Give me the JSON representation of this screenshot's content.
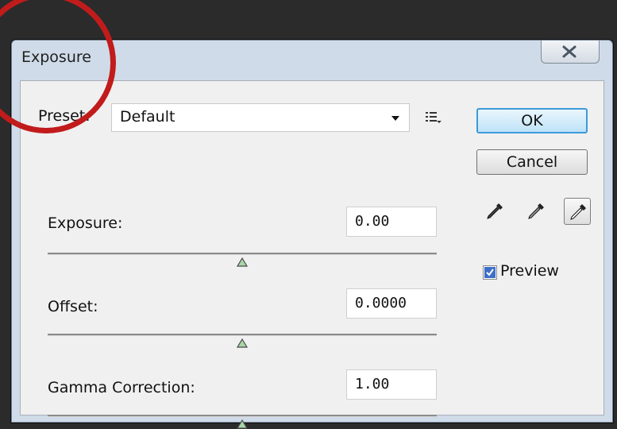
{
  "dialog": {
    "title": "Exposure",
    "close_label": "X"
  },
  "preset": {
    "label": "Preset:",
    "value": "Default"
  },
  "fields": [
    {
      "label": "Exposure:",
      "value": "0.00",
      "slider_level": 0.5
    },
    {
      "label": "Offset:",
      "value": "0.0000",
      "slider_level": 0.5
    },
    {
      "label": "Gamma Correction:",
      "value": "1.00",
      "slider_level": 0.5
    }
  ],
  "buttons": {
    "ok": "OK",
    "cancel": "Cancel"
  },
  "eyedroppers": [
    {
      "icon": "black-point-eyedropper-icon"
    },
    {
      "icon": "gray-point-eyedropper-icon"
    },
    {
      "icon": "white-point-eyedropper-icon",
      "selected": true
    }
  ],
  "preview": {
    "label": "Preview",
    "checked": true
  },
  "colors": {
    "highlight_ring": "#c11b1b",
    "ok_border": "#3d9ad8",
    "slider_thumb": "#6ea86e"
  }
}
